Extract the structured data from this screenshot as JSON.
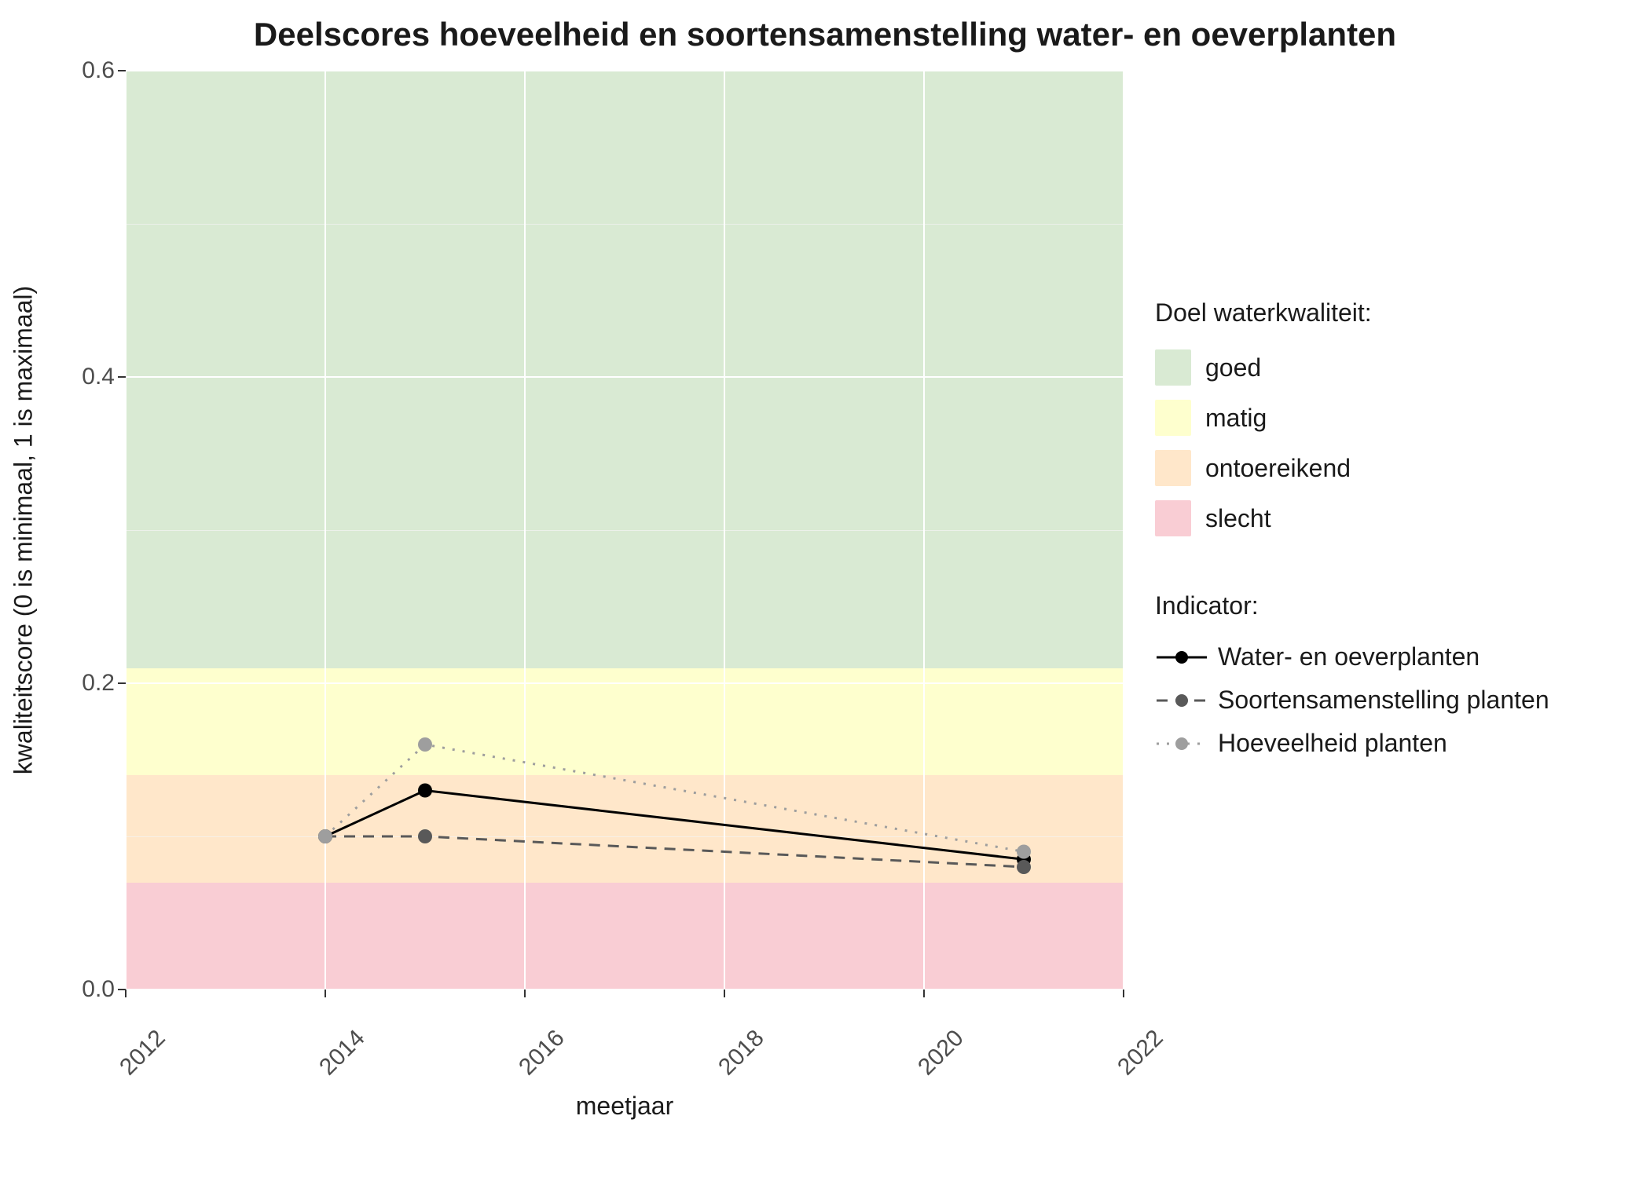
{
  "title": "Deelscores hoeveelheid en soortensamenstelling water- en oeverplanten",
  "xlabel": "meetjaar",
  "ylabel": "kwaliteitscore (0 is minimaal, 1 is maximaal)",
  "y_ticks": [
    0.0,
    0.2,
    0.4,
    0.6
  ],
  "x_ticks": [
    2012,
    2014,
    2016,
    2018,
    2020,
    2022
  ],
  "ylim": [
    0.0,
    0.6
  ],
  "xlim": [
    2012,
    2022
  ],
  "legend_quality": {
    "title": "Doel waterkwaliteit:",
    "items": [
      {
        "label": "goed",
        "color": "#d9ead3"
      },
      {
        "label": "matig",
        "color": "#feffce"
      },
      {
        "label": "ontoereikend",
        "color": "#ffe7ca"
      },
      {
        "label": "slecht",
        "color": "#f9cdd4"
      }
    ]
  },
  "legend_indicator": {
    "title": "Indicator:",
    "items": [
      {
        "label": "Water- en oeverplanten",
        "color": "#000000",
        "dash": "solid"
      },
      {
        "label": "Soortensamenstelling planten",
        "color": "#595959",
        "dash": "dashed"
      },
      {
        "label": "Hoeveelheid planten",
        "color": "#9e9e9e",
        "dash": "dotted"
      }
    ]
  },
  "bands": [
    {
      "name": "goed",
      "from": 0.21,
      "to": 0.6,
      "color": "#d9ead3"
    },
    {
      "name": "matig",
      "from": 0.14,
      "to": 0.21,
      "color": "#feffce"
    },
    {
      "name": "ontoereikend",
      "from": 0.07,
      "to": 0.14,
      "color": "#ffe7ca"
    },
    {
      "name": "slecht",
      "from": 0.0,
      "to": 0.07,
      "color": "#f9cdd4"
    }
  ],
  "chart_data": {
    "type": "line",
    "title": "Deelscores hoeveelheid en soortensamenstelling water- en oeverplanten",
    "xlabel": "meetjaar",
    "ylabel": "kwaliteitscore (0 is minimaal, 1 is maximaal)",
    "xlim": [
      2012,
      2022
    ],
    "ylim": [
      0.0,
      0.6
    ],
    "x": [
      2014,
      2015,
      2021
    ],
    "series": [
      {
        "name": "Water- en oeverplanten",
        "color": "#000000",
        "dash": "solid",
        "values": [
          0.1,
          0.13,
          0.085
        ]
      },
      {
        "name": "Soortensamenstelling planten",
        "color": "#595959",
        "dash": "dashed",
        "values": [
          0.1,
          0.1,
          0.08
        ]
      },
      {
        "name": "Hoeveelheid planten",
        "color": "#9e9e9e",
        "dash": "dotted",
        "values": [
          0.1,
          0.16,
          0.09
        ]
      }
    ],
    "background_bands": [
      {
        "name": "goed",
        "from": 0.21,
        "to": 0.6
      },
      {
        "name": "matig",
        "from": 0.14,
        "to": 0.21
      },
      {
        "name": "ontoereikend",
        "from": 0.07,
        "to": 0.14
      },
      {
        "name": "slecht",
        "from": 0.0,
        "to": 0.07
      }
    ]
  }
}
